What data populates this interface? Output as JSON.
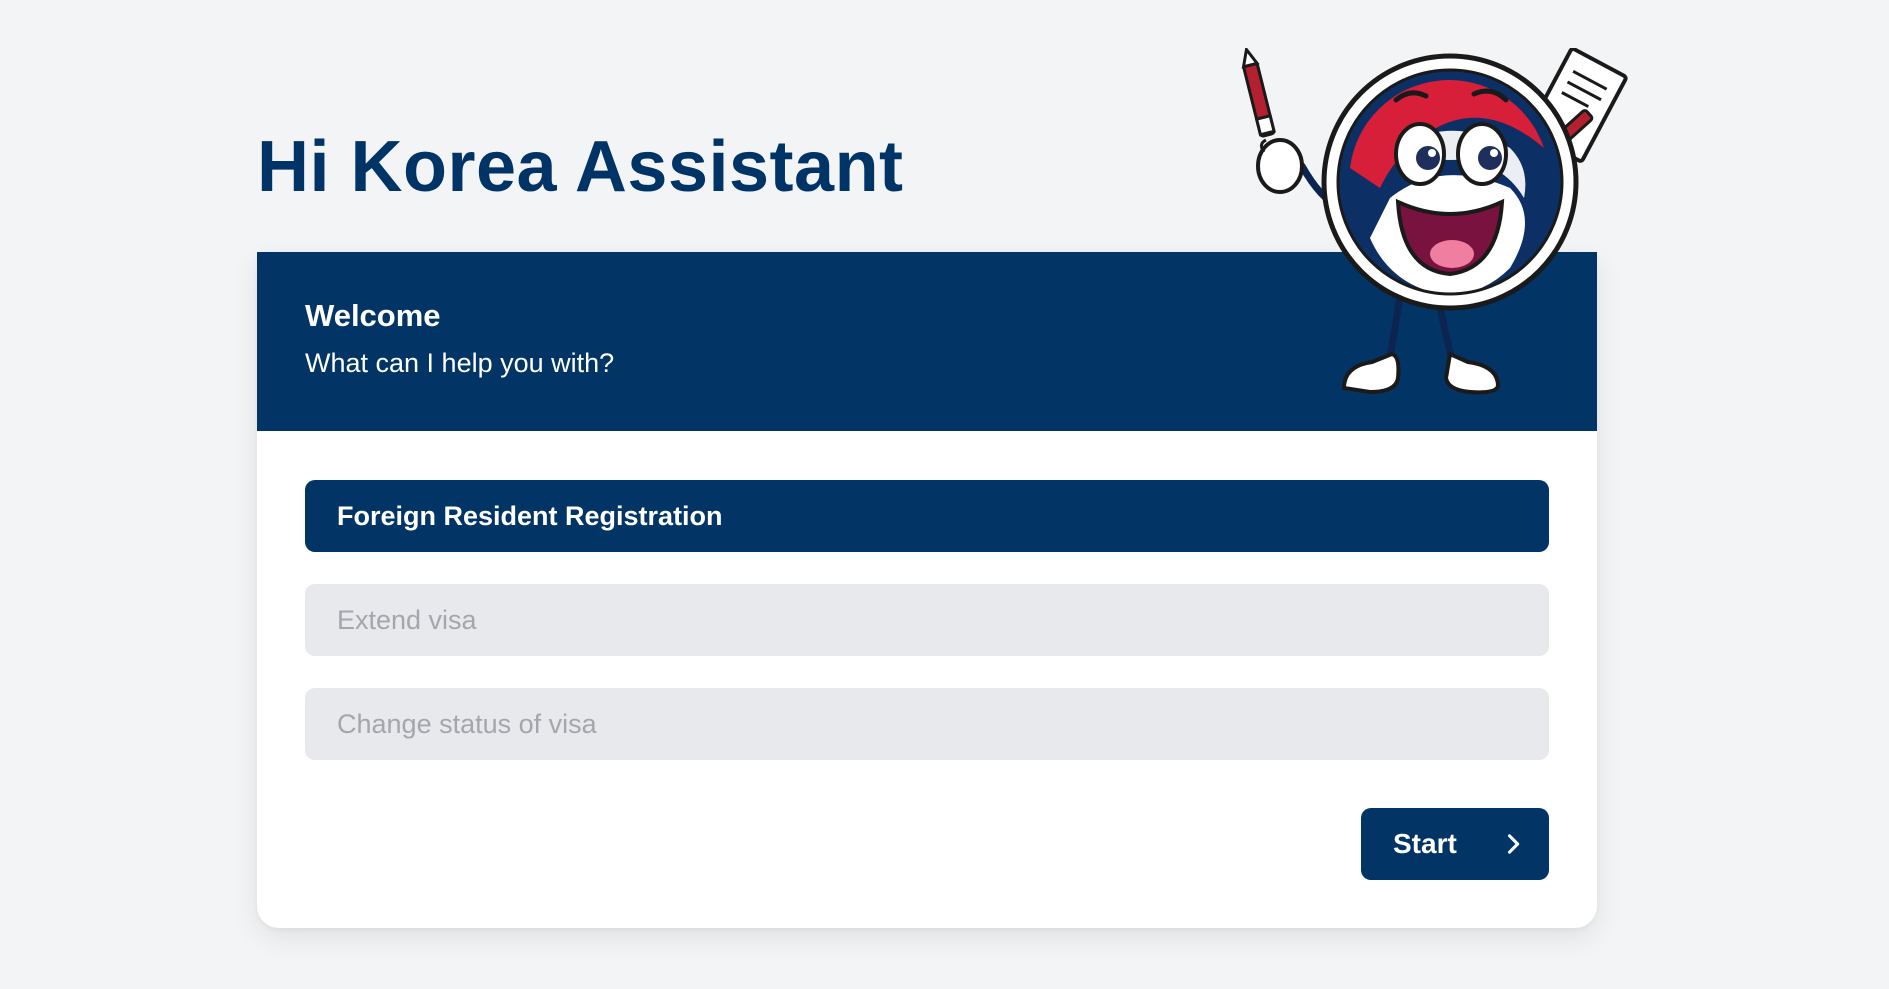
{
  "header": {
    "title": "Hi Korea Assistant"
  },
  "welcome": {
    "title": "Welcome",
    "subtitle": "What can I help you with?"
  },
  "options": [
    {
      "label": "Foreign Resident Registration",
      "selected": true
    },
    {
      "label": "Extend visa",
      "selected": false
    },
    {
      "label": "Change status of visa",
      "selected": false
    }
  ],
  "actions": {
    "start_label": "Start",
    "start_icon": "chevron-right-icon"
  },
  "mascot": {
    "icon": "mascot-illustration"
  },
  "colors": {
    "primary": "#023466",
    "background": "#f3f4f6",
    "option_inactive": "#e8e9ed",
    "option_inactive_text": "#a3a6ad",
    "accent_red": "#d71f3a"
  }
}
